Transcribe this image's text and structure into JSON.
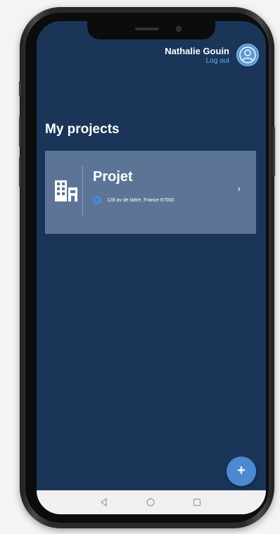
{
  "header": {
    "user_name": "Nathalie Gouin",
    "logout_label": "Log out"
  },
  "page": {
    "title": "My projects"
  },
  "projects": [
    {
      "name": "Projet",
      "address": "128 av de lattre, France  87000",
      "icon": "building-icon"
    }
  ],
  "fab": {
    "label": "+"
  },
  "colors": {
    "background": "#1a3558",
    "card": "#5c7596",
    "accent": "#4d88d2",
    "link": "#66b2ea"
  },
  "icons": {
    "avatar": "user-avatar-icon",
    "chevron": "chevron-right-icon",
    "nav_back": "back-triangle-icon",
    "nav_home": "home-circle-icon",
    "nav_recents": "recents-square-icon"
  }
}
